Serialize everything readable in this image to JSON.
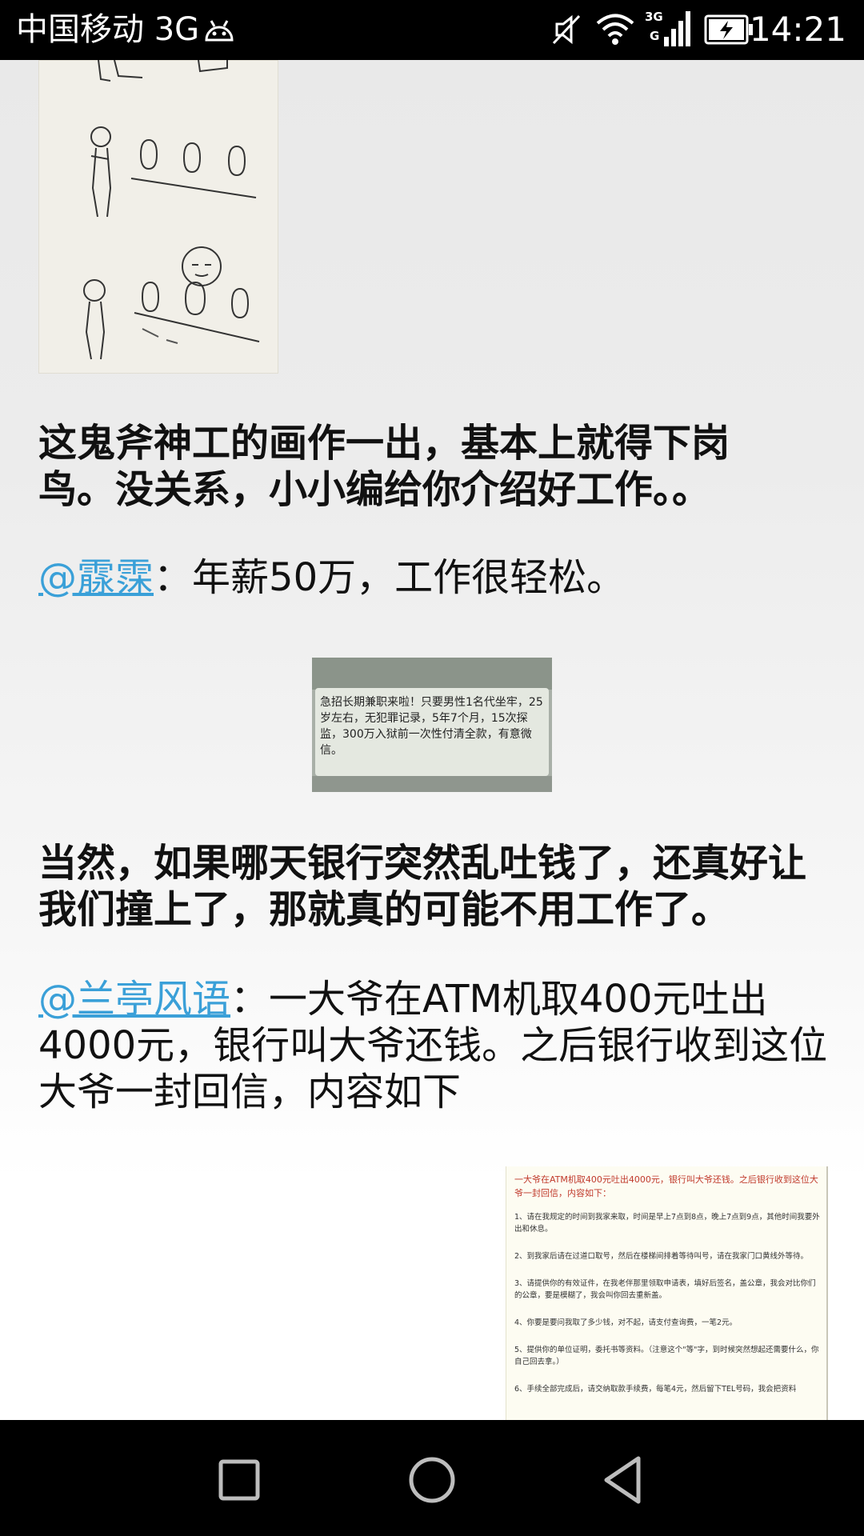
{
  "status_bar": {
    "carrier": "中国移动 3G",
    "time": "14:21",
    "icons": [
      "android-icon",
      "mute-icon",
      "wifi-icon",
      "signal-3g-icon",
      "battery-charging-icon"
    ]
  },
  "article": {
    "paragraph1": "这鬼斧神工的画作一出，基本上就得下岗鸟。没关系，小小编给你介绍好工作。。",
    "post1": {
      "mention": "@霡霂",
      "separator": "：",
      "text": "年薪50万，工作很轻松。"
    },
    "sms_image": {
      "text": "急招长期兼职来啦！只要男性1名代坐牢，25岁左右，无犯罪记录，5年7个月，15次探监，300万入狱前一次性付清全款，有意微信。"
    },
    "paragraph2": "当然，如果哪天银行突然乱吐钱了，还真好让我们撞上了，那就真的可能不用工作了。",
    "post2": {
      "mention": "@兰亭风语",
      "separator": "：",
      "text": "一大爷在ATM机取400元吐出4000元，银行叫大爷还钱。之后银行收到这位大爷一封回信，内容如下"
    },
    "letter_image": {
      "title": "一大爷在ATM机取400元吐出4000元，银行叫大爷还钱。之后银行收到这位大爷一封回信，内容如下：",
      "items": [
        "1、请在我规定的时间到我家来取，时间是早上7点到8点，晚上7点到9点，其他时间我要外出和休息。",
        "2、到我家后请在过道口取号，然后在楼梯间排着等待叫号，请在我家门口黄线外等待。",
        "3、请提供你的有效证件，在我老伴那里领取申请表，填好后签名，盖公章，我会对比你们的公章，要是模糊了，我会叫你回去重新盖。",
        "4、你要是要问我取了多少钱，对不起，请支付查询费，一笔2元。",
        "5、提供你的单位证明，委托书等资料。（注意这个\"等\"字，到时候突然想起还需要什么，你自己回去拿。）",
        "6、手续全部完成后，请交纳取款手续费，每笔4元，然后留下TEL号码，我会把资料"
      ]
    }
  },
  "nav_bar": {
    "buttons": [
      "recent-apps-icon",
      "home-icon",
      "back-icon"
    ]
  }
}
